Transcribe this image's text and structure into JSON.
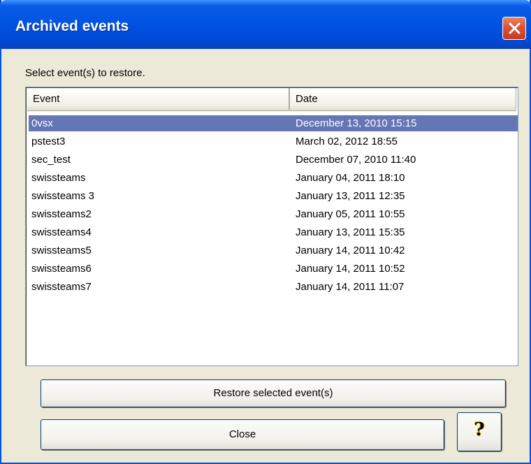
{
  "window": {
    "title": "Archived events",
    "instruction": "Select event(s) to restore."
  },
  "list": {
    "columns": [
      "Event",
      "Date"
    ],
    "rows": [
      {
        "event": "0vsx",
        "date": "December 13, 2010 15:15",
        "selected": true
      },
      {
        "event": "pstest3",
        "date": "March 02, 2012 18:55",
        "selected": false
      },
      {
        "event": "sec_test",
        "date": "December 07, 2010 11:40",
        "selected": false
      },
      {
        "event": "swissteams",
        "date": "January 04, 2011 18:10",
        "selected": false
      },
      {
        "event": "swissteams 3",
        "date": "January 13, 2011 12:35",
        "selected": false
      },
      {
        "event": "swissteams2",
        "date": "January 05, 2011 10:55",
        "selected": false
      },
      {
        "event": "swissteams4",
        "date": "January 13, 2011 15:35",
        "selected": false
      },
      {
        "event": "swissteams5",
        "date": "January 14, 2011 10:42",
        "selected": false
      },
      {
        "event": "swissteams6",
        "date": "January 14, 2011 10:52",
        "selected": false
      },
      {
        "event": "swissteams7",
        "date": "January 14, 2011 11:07",
        "selected": false
      }
    ]
  },
  "buttons": {
    "restore": "Restore selected event(s)",
    "close": "Close",
    "help_icon": "question-mark-icon"
  },
  "colors": {
    "titlebar": "#0052e2",
    "dialog_bg": "#ece9d8",
    "selection": "#6476b3",
    "close_button": "#d9533a"
  }
}
